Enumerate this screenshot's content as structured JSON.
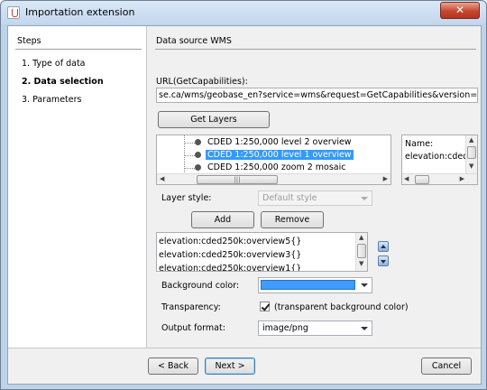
{
  "window": {
    "title": "Importation extension",
    "close_glyph": "✕"
  },
  "steps": {
    "title": "Steps",
    "items": [
      {
        "label": "1.  Type of data",
        "active": false
      },
      {
        "label": "2.  Data selection",
        "active": true
      },
      {
        "label": "3.  Parameters",
        "active": false
      }
    ]
  },
  "content": {
    "title": "Data source WMS",
    "url_label": "URL(GetCapabilities):",
    "url_value": "se.ca/wms/geobase_en?service=wms&request=GetCapabilities&version=1.1.1",
    "get_layers_label": "Get Layers",
    "layers": [
      "CDED 1:250,000 level 2 overview",
      "CDED 1:250,000 level 1 overview",
      "CDED 1:250,000 zoom 2 mosaic"
    ],
    "selected_layer_index": 1,
    "info_box": {
      "name_label": "Name:",
      "name_value": "elevation:cded"
    },
    "layer_style_label": "Layer style:",
    "layer_style_value": "Default style",
    "add_label": "Add",
    "remove_label": "Remove",
    "style_list": [
      "elevation:cded250k:overview5{}",
      "elevation:cded250k:overview3{}",
      "elevation:cded250k:overview1{}"
    ],
    "background_color_label": "Background color:",
    "background_color": "#3f9bff",
    "transparency_label": "Transparency:",
    "transparency_checked": true,
    "transparency_text": "(transparent background color)",
    "output_format_label": "Output format:",
    "output_format_value": "image/png"
  },
  "footer": {
    "back_label": "< Back",
    "next_label": "Next >",
    "cancel_label": "Cancel"
  }
}
